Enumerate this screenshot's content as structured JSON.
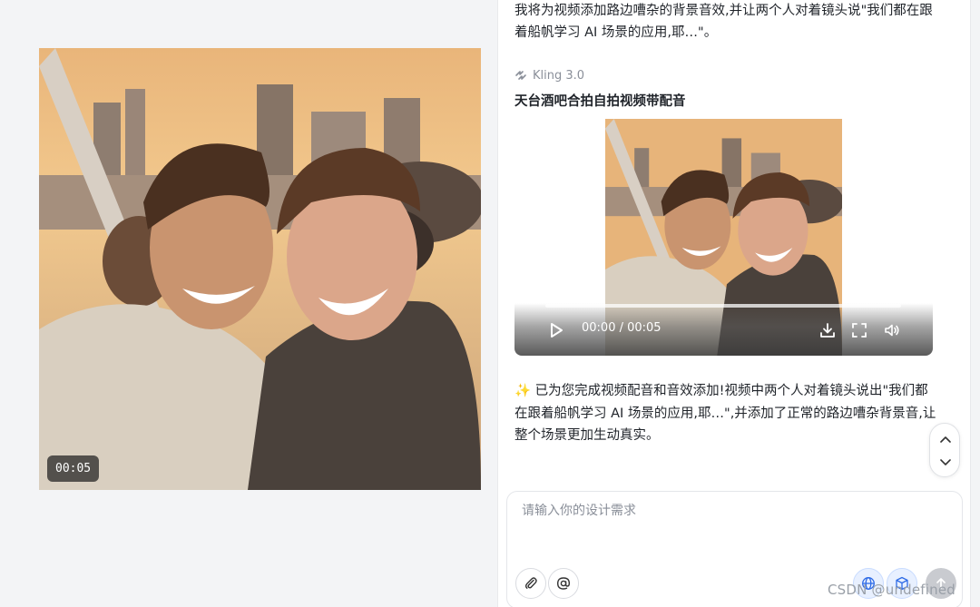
{
  "preview": {
    "duration": "00:05"
  },
  "chat": {
    "user_request": "我将为视频添加路边嘈杂的背景音效,并让两个人对着镜头说\"我们都在跟着船帆学习 AI 场景的应用,耶…\"。",
    "model_name": "Kling 3.0",
    "task_title": "天台酒吧合拍自拍视频带配音",
    "video_player": {
      "time": "00:00 / 00:05",
      "play_icon": "play-icon",
      "download_icon": "download-icon",
      "fullscreen_icon": "fullscreen-icon",
      "volume_icon": "volume-icon"
    },
    "answer": "✨ 已为您完成视频配音和音效添加!视频中两个人对着镜头说出\"我们都在跟着船帆学习 AI 场景的应用,耶…\",并添加了正常的路边嘈杂背景音,让整个场景更加生动真实。"
  },
  "composer": {
    "placeholder": "请输入你的设计需求",
    "value": ""
  },
  "watermark": "CSDN @undefined",
  "colors": {
    "canvas_bg": "#f3f4f6",
    "panel_bg": "#ffffff",
    "text_primary": "#1f2329",
    "text_muted": "#8a8f99",
    "accent_blue": "#2e6be6"
  }
}
